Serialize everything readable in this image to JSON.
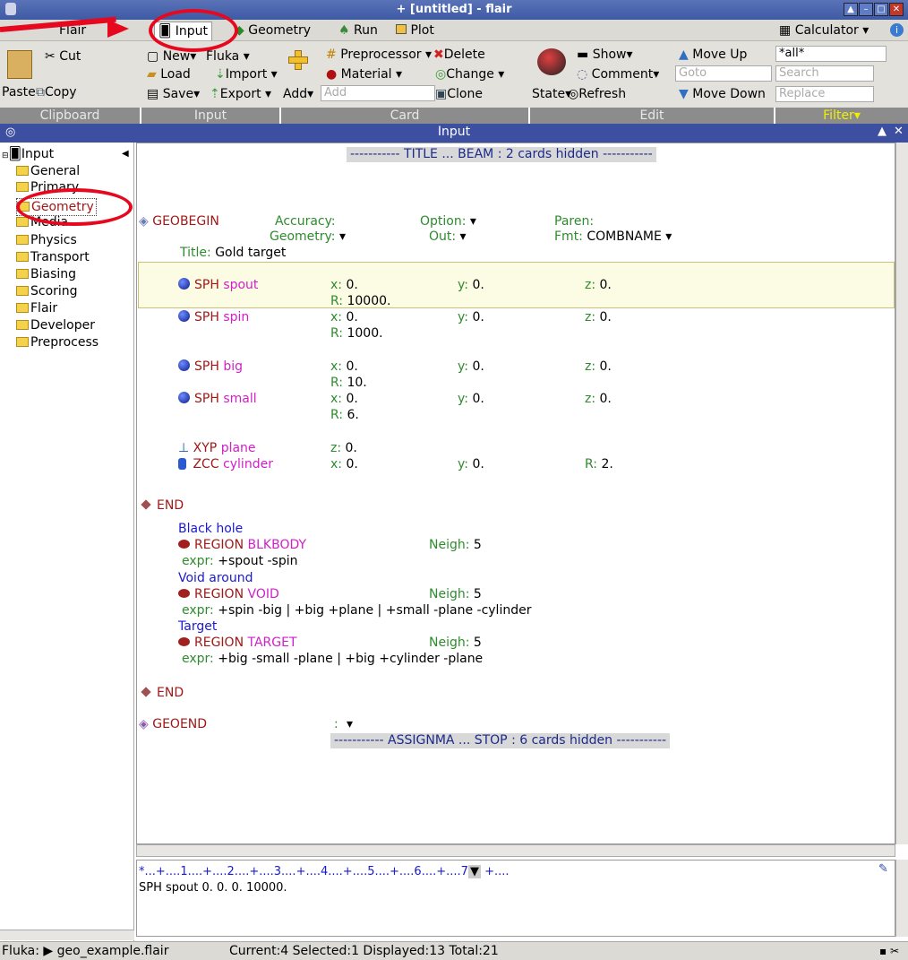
{
  "window": {
    "title": "+ [untitled] - flair"
  },
  "tabs": [
    {
      "label": "Flair"
    },
    {
      "label": "Input"
    },
    {
      "label": "Geometry"
    },
    {
      "label": "Run"
    },
    {
      "label": "Plot"
    }
  ],
  "calculator": "Calculator",
  "ribbon": {
    "clipboard": {
      "paste": "Paste",
      "cut": "Cut",
      "copy": "Copy",
      "group": "Clipboard"
    },
    "input": {
      "new": "New",
      "fluka": "Fluka",
      "load": "Load",
      "import": "Import",
      "save": "Save",
      "export": "Export",
      "group": "Input"
    },
    "card": {
      "add": "Add",
      "add_placeholder": "Add",
      "preprocessor": "Preprocessor",
      "delete": "Delete",
      "material": "Material",
      "change": "Change",
      "clone": "Clone",
      "group": "Card"
    },
    "edit": {
      "show": "Show",
      "comment": "Comment",
      "goto_placeholder": "Goto",
      "move_up": "Move Up",
      "move_down": "Move Down",
      "refresh": "Refresh",
      "state": "State",
      "group": "Edit"
    },
    "filter": {
      "value": "*all*",
      "search_placeholder": "Search",
      "replace_placeholder": "Replace",
      "group": "Filter"
    }
  },
  "panel_title": "Input",
  "tree": {
    "root": "Input",
    "items": [
      "General",
      "Primary",
      "Geometry",
      "Media",
      "Physics",
      "Transport",
      "Biasing",
      "Scoring",
      "Flair",
      "Developer",
      "Preprocess"
    ]
  },
  "editor": {
    "hidden_top": "----------- TITLE ... BEAM : 2 cards hidden -----------",
    "geobegin": {
      "kw": "GEOBEGIN",
      "accuracy": "Accuracy:",
      "option": "Option:",
      "paren": "Paren:",
      "geometry": "Geometry:",
      "out": "Out:",
      "fmt": "Fmt:",
      "fmt_value": "COMBNAME",
      "title_label": "Title:",
      "title_value": "Gold target"
    },
    "bodies": [
      {
        "type": "SPH",
        "name": "spout",
        "x": "0.",
        "y": "0.",
        "z": "0.",
        "r": "10000."
      },
      {
        "type": "SPH",
        "name": "spin",
        "x": "0.",
        "y": "0.",
        "z": "0.",
        "r": "1000."
      },
      {
        "type": "SPH",
        "name": "big",
        "x": "0.",
        "y": "0.",
        "z": "0.",
        "r": "10."
      },
      {
        "type": "SPH",
        "name": "small",
        "x": "0.",
        "y": "0.",
        "z": "0.",
        "r": "6."
      }
    ],
    "xyp": {
      "type": "XYP",
      "name": "plane",
      "z": "0."
    },
    "zcc": {
      "type": "ZCC",
      "name": "cylinder",
      "x": "0.",
      "y": "0.",
      "r": "2."
    },
    "end1": "END",
    "regions": [
      {
        "comment": "Black hole",
        "kw": "REGION",
        "name": "BLKBODY",
        "neigh": "5",
        "expr": "+spout -spin"
      },
      {
        "comment": "Void around",
        "kw": "REGION",
        "name": "VOID",
        "neigh": "5",
        "expr": "+spin -big | +big +plane | +small -plane -cylinder"
      },
      {
        "comment": "Target",
        "kw": "REGION",
        "name": "TARGET",
        "neigh": "5",
        "expr": "+big -small -plane | +big +cylinder -plane"
      }
    ],
    "end2": "END",
    "geoend": "GEOEND",
    "hidden_bottom": "----------- ASSIGNMA ... STOP : 6 cards hidden -----------"
  },
  "ruler": "*...+....1....+....2....+....3....+....4....+....5....+....6....+....7",
  "ruler_tail": "+....",
  "card_line": "SPH spout    0. 0. 0. 10000.",
  "status": {
    "left": "Fluka: ▶ geo_example.flair",
    "right": "Current:4 Selected:1 Displayed:13 Total:21"
  }
}
